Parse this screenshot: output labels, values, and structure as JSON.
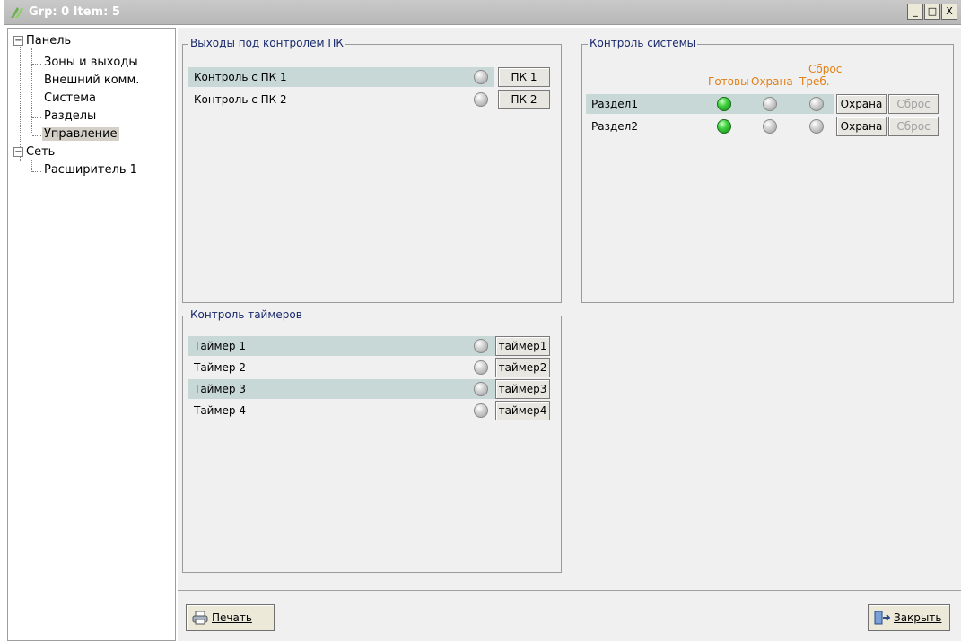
{
  "window": {
    "title": "Grp: 0 Item: 5",
    "minimize": "_",
    "maximize": "□",
    "close": "X"
  },
  "tree": {
    "panel": "Панель",
    "panel_children": [
      "Зоны и выходы",
      "Внешний комм.",
      "Система",
      "Разделы",
      "Управление"
    ],
    "network": "Сеть",
    "network_children": [
      "Расширитель 1"
    ],
    "selected": "Управление"
  },
  "pc_outputs": {
    "title": "Выходы под контролем ПК",
    "rows": [
      {
        "label": "Контроль с ПК 1",
        "button": "ПК 1"
      },
      {
        "label": "Контроль с ПК 2",
        "button": "ПК 2"
      }
    ]
  },
  "system_control": {
    "title": "Контроль системы",
    "headers": {
      "ready": "Готовы",
      "guard": "Охрана",
      "reset_top": "Сброс",
      "reset_bottom": "Треб."
    },
    "rows": [
      {
        "label": "Раздел1",
        "ready": "green",
        "guard_button": "Охрана",
        "reset_button": "Сброс"
      },
      {
        "label": "Раздел2",
        "ready": "green",
        "guard_button": "Охрана",
        "reset_button": "Сброс"
      }
    ]
  },
  "timers": {
    "title": "Контроль таймеров",
    "rows": [
      {
        "label": "Таймер 1",
        "button": "таймер1"
      },
      {
        "label": "Таймер 2",
        "button": "таймер2"
      },
      {
        "label": "Таймер 3",
        "button": "таймер3"
      },
      {
        "label": "Таймер 4",
        "button": "таймер4"
      }
    ]
  },
  "footer": {
    "print": "Печать",
    "close": "Закрыть"
  },
  "colors": {
    "row_highlight": "#c7d8d6",
    "header_orange": "#e08018",
    "group_title": "#1a2a6c",
    "led_green": "#3fd03f"
  }
}
